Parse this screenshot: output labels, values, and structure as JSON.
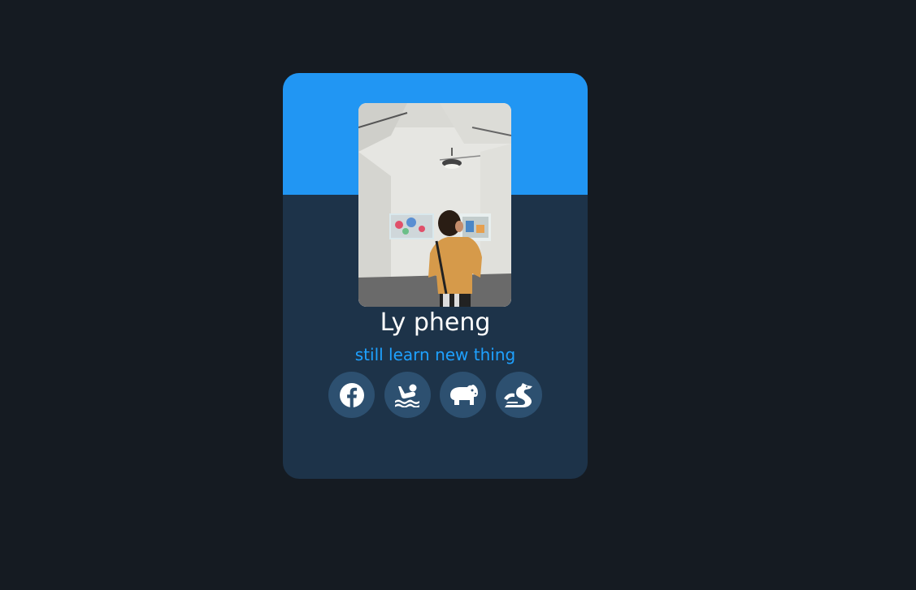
{
  "profile": {
    "name": "Ly pheng",
    "tagline": "still learn new thing"
  },
  "socials": [
    {
      "icon": "facebook-icon"
    },
    {
      "icon": "swimmer-icon"
    },
    {
      "icon": "hippo-icon"
    },
    {
      "icon": "dragon-icon"
    }
  ],
  "colors": {
    "background": "#151b22",
    "card": "#1d3349",
    "accent": "#2196f3",
    "tagline": "#1ea1ff",
    "social_button": "#2d5070"
  }
}
